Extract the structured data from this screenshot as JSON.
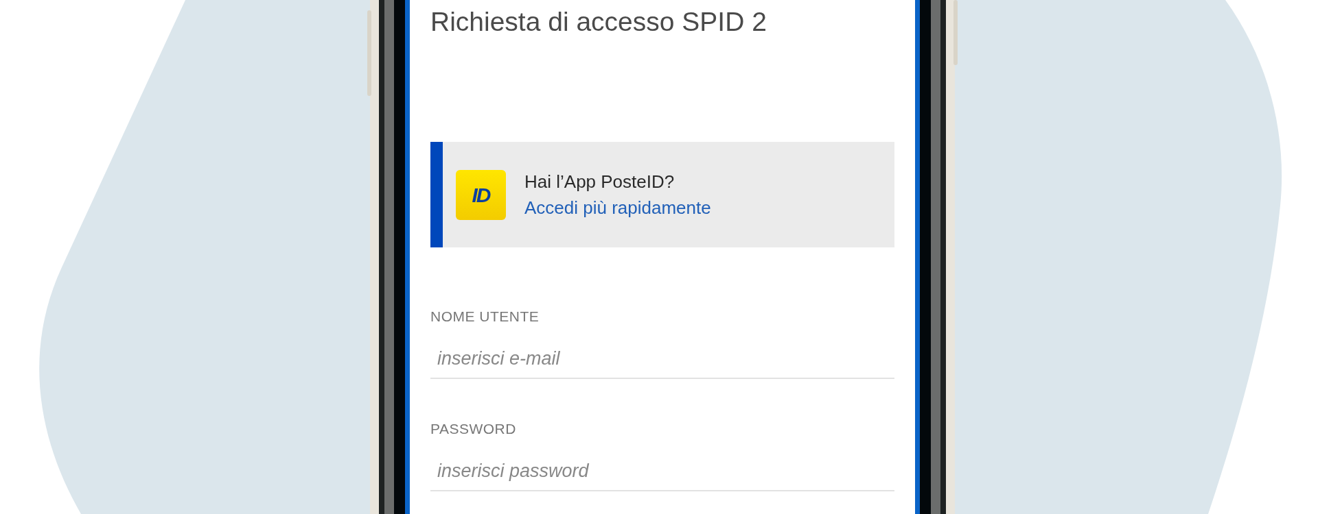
{
  "title": "Richiesta di accesso SPID 2",
  "app_banner": {
    "icon_text": "ID",
    "question": "Hai l’App PosteID?",
    "link": "Accedi più rapidamente"
  },
  "fields": [
    {
      "label": "NOME UTENTE",
      "placeholder": "inserisci e-mail"
    },
    {
      "label": "PASSWORD",
      "placeholder": "inserisci password"
    }
  ]
}
